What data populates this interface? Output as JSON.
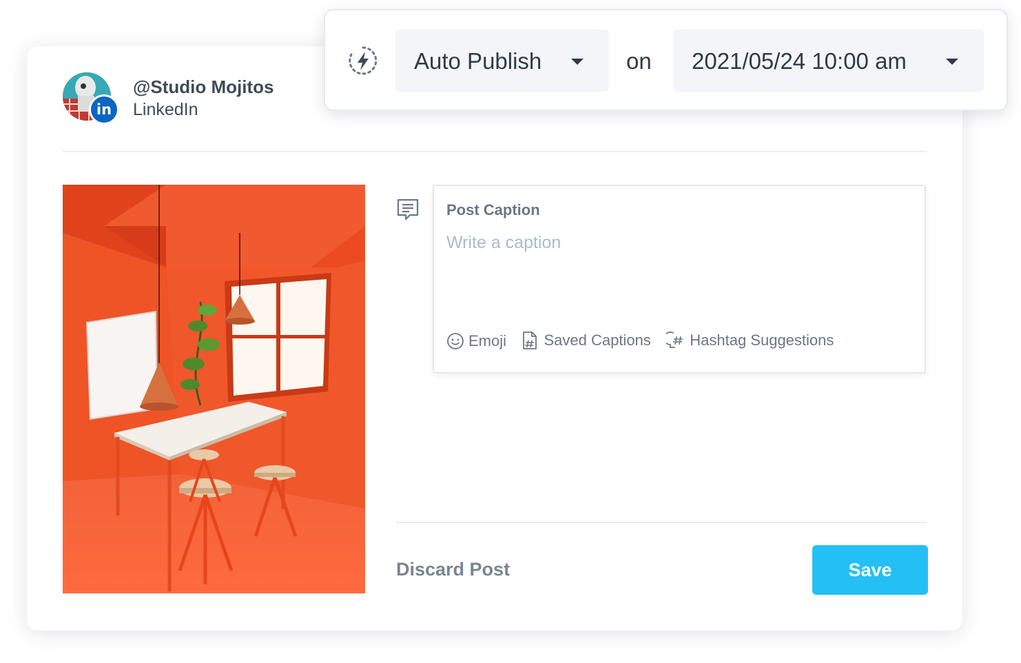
{
  "account": {
    "handle": "@Studio Mojitos",
    "network": "LinkedIn",
    "badge": "in"
  },
  "schedule": {
    "mode": "Auto Publish",
    "connector": "on",
    "datetime": "2021/05/24 10:00 am"
  },
  "caption": {
    "label": "Post Caption",
    "placeholder": "Write a caption",
    "value": ""
  },
  "tools": {
    "emoji": "Emoji",
    "saved_captions": "Saved Captions",
    "hashtags": "Hashtag Suggestions"
  },
  "actions": {
    "discard": "Discard Post",
    "save": "Save"
  },
  "colors": {
    "primary": "#24c0f5",
    "linkedin": "#0a66c2",
    "room": "#f0522a"
  }
}
